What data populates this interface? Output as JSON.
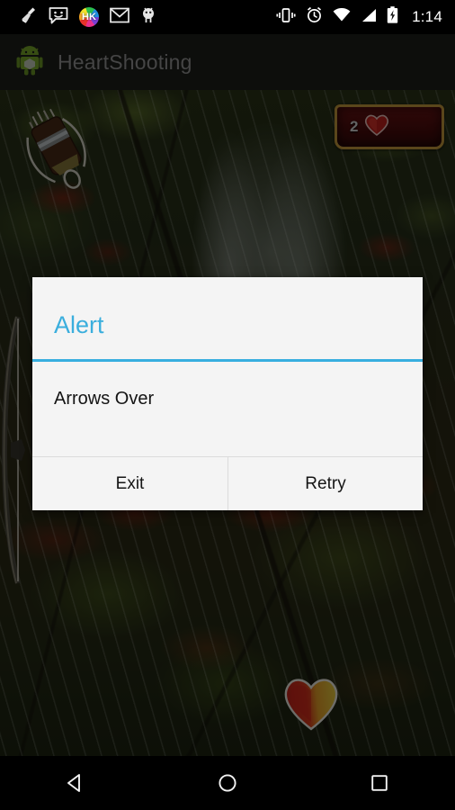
{
  "status_bar": {
    "time": "1:14",
    "left_icons": [
      {
        "name": "broom-cleaner-icon",
        "label": "Cleaner"
      },
      {
        "name": "message-smiley-icon",
        "label": "Messages"
      },
      {
        "name": "hk-app-icon",
        "label": "HK"
      },
      {
        "name": "gmail-icon",
        "label": "Gmail"
      },
      {
        "name": "android-bug-icon",
        "label": "Debug"
      }
    ],
    "right_icons": [
      {
        "name": "vibrate-icon",
        "label": "Vibrate"
      },
      {
        "name": "alarm-clock-icon",
        "label": "Alarm set"
      },
      {
        "name": "wifi-icon",
        "label": "Wi-Fi"
      },
      {
        "name": "cellular-signal-icon",
        "label": "Signal"
      },
      {
        "name": "battery-charging-icon",
        "label": "Charging"
      }
    ]
  },
  "action_bar": {
    "app_icon": "android-robot-icon",
    "title": "HeartShooting"
  },
  "game": {
    "hud": {
      "score_value": "2",
      "score_icon": "heart-icon"
    },
    "elements": [
      {
        "name": "quiver-with-arrows",
        "label": "Quiver"
      },
      {
        "name": "bow",
        "label": "Bow"
      },
      {
        "name": "heart-target",
        "label": "Heart target"
      }
    ],
    "background_description": "Rainy autumn forest with waterfall"
  },
  "dialog": {
    "title": "Alert",
    "message": "Arrows Over",
    "buttons": [
      {
        "name": "exit-button",
        "label": "Exit"
      },
      {
        "name": "retry-button",
        "label": "Retry"
      }
    ]
  },
  "nav_bar": {
    "back": "back-nav-button",
    "home": "home-nav-button",
    "recents": "recents-nav-button"
  },
  "colors": {
    "dialog_accent": "#38AEDF",
    "dialog_bg": "#F4F4F4",
    "action_bar_bg": "#1D1F1C",
    "hud_border": "#C79B3C",
    "hud_bg": "#4D0D0D",
    "heart_red": "#D5231E",
    "heart_yellow": "#E8C23A",
    "status_bar_bg": "#000000"
  }
}
